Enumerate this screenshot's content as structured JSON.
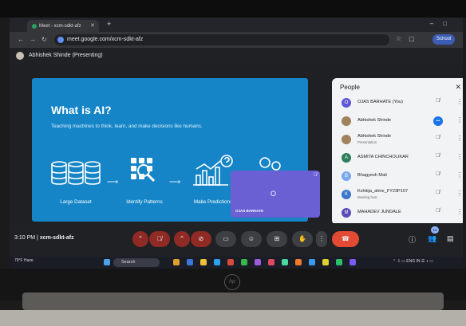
{
  "browser": {
    "tab_title": "Meet - xcm-sdkt-afz",
    "url": "meet.google.com/xcm-sdkt-afz",
    "profile_label": "School"
  },
  "meet": {
    "presenting_label": "Abhishek Shinde (Presenting)",
    "time": "3:10 PM",
    "separator": "|",
    "meeting_code": "xcm-sdkt-afz",
    "participant_count": "14",
    "self_tile_initial": "O",
    "self_tile_name": "OJAS BARHATE"
  },
  "slide": {
    "title": "What is AI?",
    "subtitle": "Teaching machines to think, learn, and make decisions like humans.",
    "stages": [
      {
        "label": "Large Dataset"
      },
      {
        "label": "Identify Patterns"
      },
      {
        "label": "Make Predictions"
      }
    ]
  },
  "people": {
    "title": "People",
    "participants": [
      {
        "name": "OJAS BARHATE (You)",
        "sub": "",
        "initial": "O",
        "color": "#5f57d8",
        "mic": "muted"
      },
      {
        "name": "Abhishek Shinde",
        "sub": "",
        "initial": "",
        "color": "#a0825d",
        "mic": "speaking"
      },
      {
        "name": "Abhishek Shinde",
        "sub": "Presentation",
        "initial": "",
        "color": "#a0825d",
        "mic": "muted"
      },
      {
        "name": "ASMITA CHINCHOLIKAR",
        "sub": "",
        "initial": "A",
        "color": "#2e7d5b",
        "mic": "muted"
      },
      {
        "name": "Bhagyesh Mali",
        "sub": "",
        "initial": "B",
        "color": "#7aa7f0",
        "mic": "muted"
      },
      {
        "name": "Kshitija_ahire_FY23P107",
        "sub": "Meeting host",
        "initial": "K",
        "color": "#3e76c9",
        "mic": "muted"
      },
      {
        "name": "MAHADEV JUNDALE",
        "sub": "",
        "initial": "M",
        "color": "#5a4bb5",
        "mic": "muted"
      }
    ]
  },
  "taskbar": {
    "weather_temp": "79°F",
    "weather_desc": "Haze",
    "search_label": "Search",
    "lang": "ENG",
    "lang_region": "IN"
  },
  "laptop": {
    "brand_logo": "hp"
  },
  "colors": {
    "slide_bg": "#1585c7",
    "leave_red": "#e34a33",
    "mute_red": "#8f2a24",
    "tile_purple": "#6a5fd3"
  }
}
